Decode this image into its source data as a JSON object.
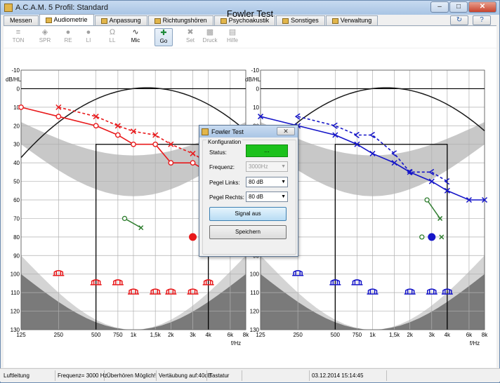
{
  "window": {
    "title": "A.C.A.M. 5  Profil: Standard",
    "buttons": [
      "minimize",
      "maximize",
      "close"
    ]
  },
  "tabs": [
    {
      "label": "Messen",
      "active": false
    },
    {
      "label": "Audiometrie",
      "active": true
    },
    {
      "label": "Anpassung",
      "active": false
    },
    {
      "label": "Richtungshören",
      "active": false
    },
    {
      "label": "Psychoakustik",
      "active": false
    },
    {
      "label": "Sonstiges",
      "active": false
    },
    {
      "label": "Verwaltung",
      "active": false
    }
  ],
  "toolbar": [
    {
      "label": "TON",
      "icon": "tone-icon",
      "enabled": false
    },
    {
      "label": "SPR",
      "icon": "speech-icon",
      "enabled": false
    },
    {
      "label": "RE",
      "icon": "right-ear-icon",
      "enabled": false
    },
    {
      "label": "LI",
      "icon": "left-ear-icon",
      "enabled": false
    },
    {
      "label": "LL",
      "icon": "headphones-icon",
      "enabled": false
    },
    {
      "label": "Mic",
      "icon": "microphone-icon",
      "enabled": true
    },
    {
      "label": "Go",
      "icon": "go-icon",
      "enabled": true,
      "pressed": true
    },
    {
      "label": "Set",
      "icon": "tools-icon",
      "enabled": false
    },
    {
      "label": "Druck",
      "icon": "printer-icon",
      "enabled": false
    },
    {
      "label": "Hilfe",
      "icon": "help-icon",
      "enabled": false
    }
  ],
  "chart": {
    "title": "Fowler Test",
    "y_unit": "dB/HL",
    "x_unit": "f/Hz"
  },
  "chart_data": {
    "type": "line",
    "title": "Fowler Test",
    "xlabel": "f/Hz",
    "ylabel": "dB/HL",
    "xscale": "log",
    "x_ticks": [
      "125",
      "250",
      "500",
      "750",
      "1k",
      "1,5k",
      "2k",
      "3k",
      "4k",
      "6k",
      "8k"
    ],
    "y_ticks": [
      -10,
      0,
      10,
      20,
      30,
      40,
      50,
      60,
      70,
      80,
      90,
      100,
      110,
      120,
      130
    ],
    "ylim": [
      130,
      -10
    ],
    "grid": true,
    "panels": [
      {
        "ear": "right",
        "color": "#e8191b",
        "series": [
          {
            "style": "solid",
            "marker": "circle",
            "x": [
              125,
              250,
              500,
              750,
              1000,
              1500,
              2000,
              3000,
              4000
            ],
            "y": [
              10,
              15,
              20,
              25,
              30,
              30,
              40,
              40,
              45
            ]
          },
          {
            "style": "dashed",
            "marker": "x",
            "x": [
              250,
              500,
              750,
              1000,
              1500,
              2000,
              3000,
              4000
            ],
            "y": [
              10,
              15,
              20,
              23,
              25,
              30,
              35,
              40
            ]
          },
          {
            "style": "solid",
            "marker": "bracket",
            "x": [
              250,
              500,
              750,
              1000,
              1500,
              2000,
              3000,
              4000
            ],
            "y": [
              100,
              105,
              105,
              110,
              110,
              110,
              110,
              105
            ]
          }
        ],
        "comfort_curve": {
          "color": "#1a1a1a"
        },
        "green_pair": {
          "color": "#2e7d2e",
          "x": [
            850,
            1150
          ],
          "y": [
            70,
            75
          ]
        },
        "fowler_point": {
          "x": 3000,
          "y": 80
        }
      },
      {
        "ear": "left",
        "color": "#1515c8",
        "series": [
          {
            "style": "solid",
            "marker": "x",
            "x": [
              125,
              250,
              500,
              750,
              1000,
              1500,
              2000,
              3000,
              4000,
              6000,
              8000
            ],
            "y": [
              15,
              20,
              25,
              30,
              35,
              40,
              45,
              50,
              55,
              60,
              60
            ]
          },
          {
            "style": "dashed",
            "marker": "bracket-left",
            "x": [
              250,
              500,
              750,
              1000,
              1500,
              2000,
              3000,
              4000
            ],
            "y": [
              15,
              20,
              25,
              25,
              35,
              45,
              45,
              50
            ]
          },
          {
            "style": "solid",
            "marker": "bracket",
            "x": [
              250,
              500,
              750,
              1000,
              2000,
              3000,
              4000
            ],
            "y": [
              100,
              105,
              105,
              110,
              110,
              110,
              110
            ]
          }
        ],
        "comfort_curve": {
          "color": "#1a1a1a"
        },
        "green_pair": {
          "color": "#2e7d2e",
          "x": [
            2750,
            3500
          ],
          "y": [
            60,
            70
          ]
        },
        "fowler_point": {
          "x": 3000,
          "y": 80
        }
      }
    ]
  },
  "dialog": {
    "title": "Fowler Test",
    "group_title": "Konfiguration",
    "status_label": "Status:",
    "status_value": "...",
    "status_color": "#1cc11c",
    "freq_label": "Frequenz:",
    "freq_value": "3000Hz",
    "left_label": "Pegel Links:",
    "left_value": "80 dB",
    "right_label": "Pegel Rechts:",
    "right_value": "80 dB",
    "signal_button": "Signal aus",
    "save_button": "Speichern"
  },
  "statusbar": [
    "Luftleitung",
    "Frequenz= 3000 Hz",
    "Überhören Möglich!",
    "Vertäubung auf:40dB",
    "Tastatur",
    "",
    "03.12.2014 15:14:45",
    ""
  ]
}
